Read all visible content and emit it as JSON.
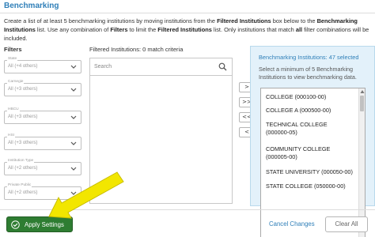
{
  "header": {
    "title": "Benchmarking"
  },
  "instructions": {
    "p1": "Create a list of at least 5 benchmarking institutions by moving institutions from the ",
    "b1": "Filtered Institutions",
    "p2": " box below to the ",
    "b2": "Benchmarking Institutions",
    "p3": " list. Use any combination of ",
    "b3": "Filters",
    "p4": " to limit the ",
    "b4": "Filtered Institutions",
    "p5": " list. Only institutions that match ",
    "b5": "all",
    "p6": " filter combinations will be included."
  },
  "filters": {
    "title": "Filters",
    "items": [
      {
        "label": "State",
        "value": "All (+4 others)"
      },
      {
        "label": "Carnegie",
        "value": "All (+3 others)"
      },
      {
        "label": "HBCU",
        "value": "All (+3 others)"
      },
      {
        "label": "HSI",
        "value": "All (+3 others)"
      },
      {
        "label": "Institution Type",
        "value": "All (+2 others)"
      },
      {
        "label": "Private Public",
        "value": "All (+2 others)"
      }
    ]
  },
  "filtered_institutions": {
    "title": "Filtered Institutions: 0 match criteria",
    "search_placeholder": "Search"
  },
  "move_buttons": [
    ">",
    ">>",
    "<<",
    "<"
  ],
  "benchmarking": {
    "title": "Benchmarking Institutions: 47 selected",
    "description": "Select a minimum of 5 Benchmarking Institutions to view benchmarking data.",
    "items": [
      "COLLEGE (000100-00)",
      "COLLEGE A (000500-00)",
      "TECHNICAL COLLEGE",
      "(000000-05)",
      "COMMUNITY COLLEGE",
      "(000005-00)",
      "STATE UNIVERSITY (000050-00)",
      "STATE COLLEGE (050000-00)"
    ]
  },
  "footer": {
    "apply_label": "Apply Settings",
    "cancel_label": "Cancel Changes",
    "clear_label": "Clear All"
  },
  "colors": {
    "accent": "#2f7fb8",
    "apply_green": "#2e7d32",
    "panel_blue": "#e3f1fa",
    "arrow_yellow": "#f2e600"
  },
  "icons": [
    "chevron-down-icon",
    "search-icon",
    "check-circle-icon",
    "scroll-up-icon",
    "pointer-arrow"
  ]
}
